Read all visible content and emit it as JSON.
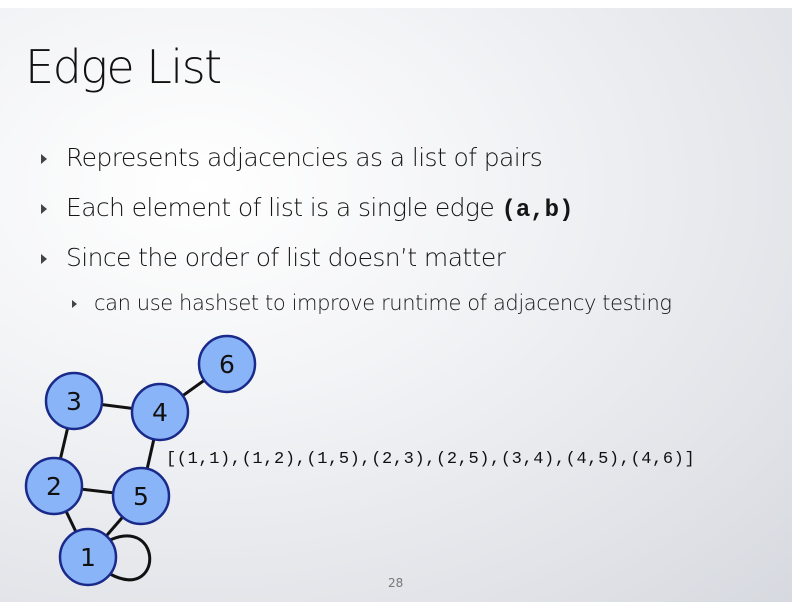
{
  "slide": {
    "title": "Edge List",
    "bullets": [
      {
        "text": "Represents adjacencies as a list of pairs"
      },
      {
        "text": "Each element of list is a single edge ",
        "code": "(a,b)"
      },
      {
        "text": "Since the order of list doesn’t matter"
      }
    ],
    "sub_bullets": [
      {
        "text": "can use hashset to improve runtime of adjacency testing"
      }
    ],
    "edge_list_text": "[(1,1),(1,2),(1,5),(2,3),(2,5),(3,4),(4,5),(4,6)]",
    "page_number": "28"
  },
  "graph": {
    "node_fill": "#8ab4f8",
    "node_stroke": "#1a2a8a",
    "edge_color": "#111111",
    "nodes": [
      {
        "id": "1",
        "label": "1"
      },
      {
        "id": "2",
        "label": "2"
      },
      {
        "id": "3",
        "label": "3"
      },
      {
        "id": "4",
        "label": "4"
      },
      {
        "id": "5",
        "label": "5"
      },
      {
        "id": "6",
        "label": "6"
      }
    ],
    "edges": [
      [
        "1",
        "1"
      ],
      [
        "1",
        "2"
      ],
      [
        "1",
        "5"
      ],
      [
        "2",
        "3"
      ],
      [
        "2",
        "5"
      ],
      [
        "3",
        "4"
      ],
      [
        "4",
        "5"
      ],
      [
        "4",
        "6"
      ]
    ]
  }
}
